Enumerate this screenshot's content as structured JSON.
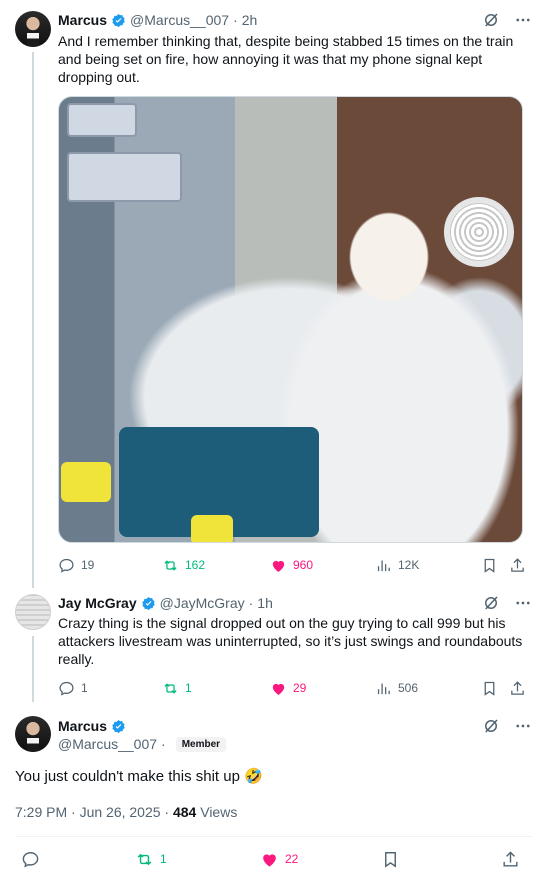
{
  "tweet1": {
    "name": "Marcus",
    "handle": "@Marcus__007",
    "dot": "·",
    "time": "2h",
    "text": "And I remember thinking that, despite being stabbed 15 times on the train and being set on fire, how annoying it was that my phone signal kept dropping out.",
    "replies": "19",
    "retweets": "162",
    "likes": "960",
    "views": "12K"
  },
  "tweet2": {
    "name": "Jay McGray",
    "handle": "@JayMcGray",
    "dot": "·",
    "time": "1h",
    "text": "Crazy thing is the signal dropped out on the guy trying to call 999 but his attackers livestream was uninterrupted, so it’s just swings and roundabouts really.",
    "replies": "1",
    "retweets": "1",
    "likes": "29",
    "views": "506"
  },
  "tweet3": {
    "name": "Marcus",
    "handle": "@Marcus__007",
    "dot": "·",
    "badge": "Member",
    "text": "You just couldn't make this shit up 🤣",
    "timestamp": "7:29 PM · Jun 26, 2025 · ",
    "views_count": "484",
    "views_label": " Views",
    "retweets": "1",
    "likes": "22"
  },
  "colors": {
    "verified": "#1d9bf0",
    "retweet": "#00ba7c",
    "like": "#f91880",
    "secondary_text": "#536471"
  }
}
